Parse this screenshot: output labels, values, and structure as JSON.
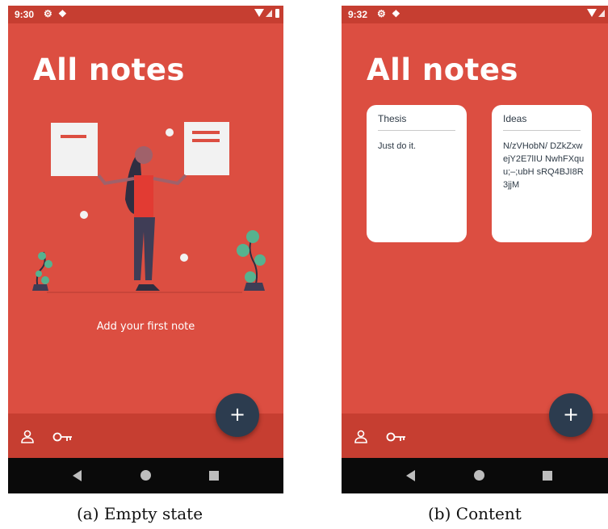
{
  "screens": [
    {
      "status_time": "9:30",
      "title": "All notes",
      "empty_message": "Add your first note",
      "fab_label": "+",
      "caption": "(a) Empty state"
    },
    {
      "status_time": "9:32",
      "title": "All notes",
      "fab_label": "+",
      "caption": "(b) Content",
      "notes": [
        {
          "title": "Thesis",
          "body": "Just do it."
        },
        {
          "title": "Ideas",
          "body": "N/zVHobN/ DZkZxwejY2E7lIU NwhFXquu;–;ubH sRQ4BJI8R3jjM"
        }
      ]
    }
  ],
  "icons": {
    "settings": "gear-icon",
    "notification": "package-icon",
    "wifi": "wifi-icon",
    "signal": "signal-icon",
    "battery": "battery-icon",
    "profile": "person-icon",
    "password": "key-icon"
  },
  "colors": {
    "background": "#dc4e41",
    "status_bar": "#c63e31",
    "fab": "#2c3c4f",
    "card": "#ffffff",
    "system_nav": "#0a0a0a"
  }
}
